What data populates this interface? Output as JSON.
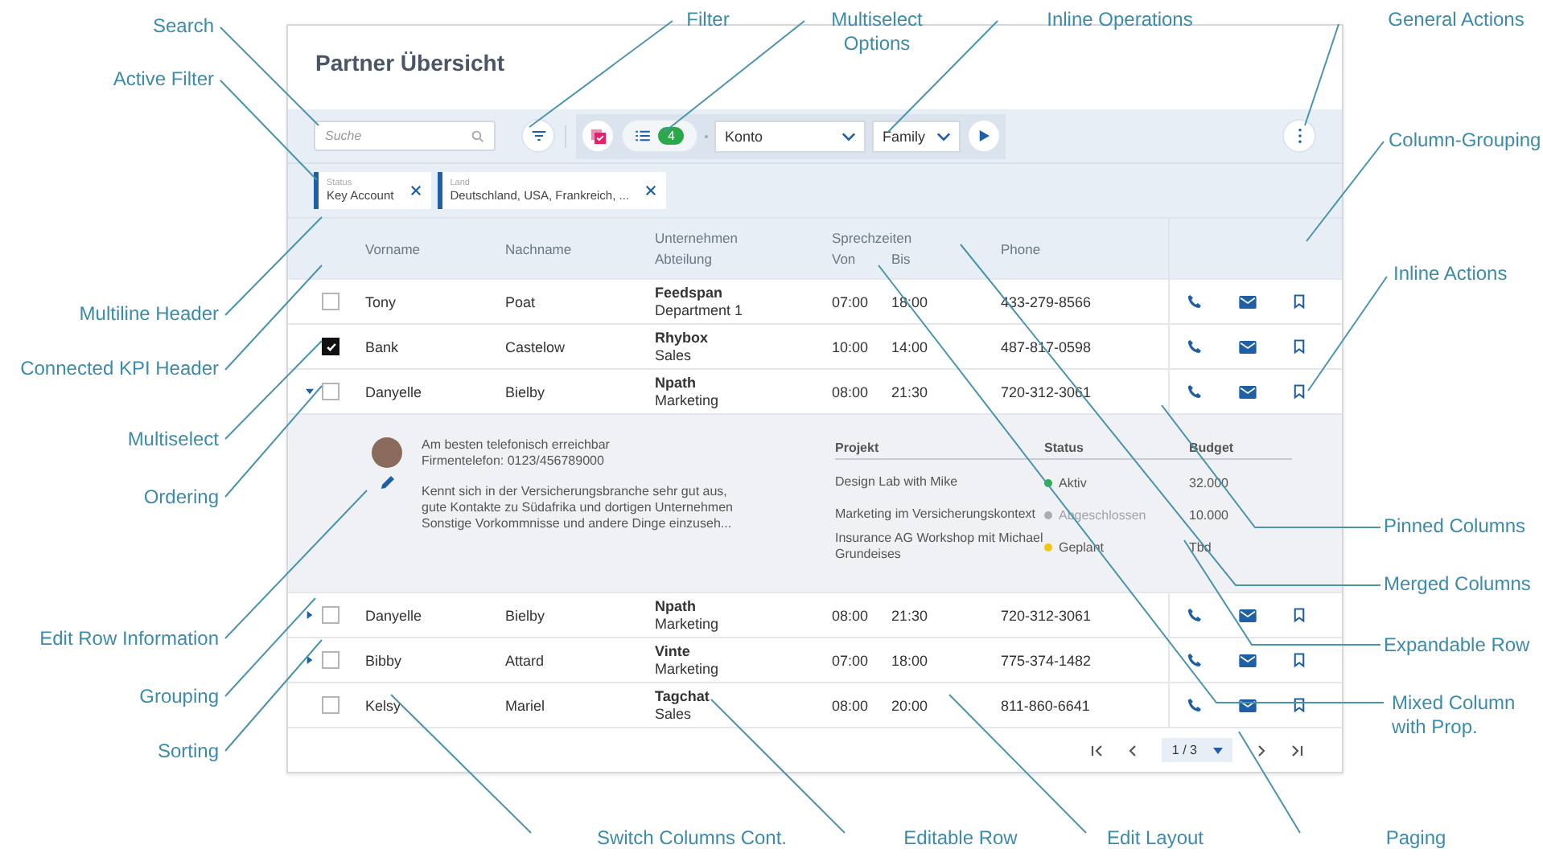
{
  "card": {
    "title": "Partner Übersicht",
    "toolbar": {
      "search": {
        "placeholder": "Suche"
      },
      "multiselect_count": "4",
      "selects": [
        "Konto",
        "Family"
      ]
    },
    "filters": [
      {
        "label": "Status",
        "value": "Key Account"
      },
      {
        "label": "Land",
        "value": "Deutschland, USA, Frankreich, ..."
      }
    ],
    "header": {
      "first": "Vorname",
      "last": "Nachname",
      "company": "Unternehmen",
      "department": "Abteilung",
      "hours": "Sprechzeiten",
      "from": "Von",
      "to": "Bis",
      "phone": "Phone"
    },
    "rows": [
      {
        "first": "Tony",
        "last": "Poat",
        "company": "Feedspan",
        "department": "Department 1",
        "from": "07:00",
        "to": "18:00",
        "phone": "433-279-8566",
        "checked": false,
        "expandable": false,
        "expanded": false
      },
      {
        "first": "Bank",
        "last": "Castelow",
        "company": "Rhybox",
        "department": "Sales",
        "from": "10:00",
        "to": "14:00",
        "phone": "487-817-0598",
        "checked": true,
        "expandable": false,
        "expanded": false
      },
      {
        "first": "Danyelle",
        "last": "Bielby",
        "company": "Npath",
        "department": "Marketing",
        "from": "08:00",
        "to": "21:30",
        "phone": "720-312-3061",
        "checked": false,
        "expandable": true,
        "expanded": true
      },
      {
        "first": "Danyelle",
        "last": "Bielby",
        "company": "Npath",
        "department": "Marketing",
        "from": "08:00",
        "to": "21:30",
        "phone": "720-312-3061",
        "checked": false,
        "expandable": true,
        "expanded": false
      },
      {
        "first": "Bibby",
        "last": "Attard",
        "company": "Vinte",
        "department": "Marketing",
        "from": "07:00",
        "to": "18:00",
        "phone": "775-374-1482",
        "checked": false,
        "expandable": true,
        "expanded": false
      },
      {
        "first": "Kelsy",
        "last": "Mariel",
        "company": "Tagchat",
        "department": "Sales",
        "from": "08:00",
        "to": "20:00",
        "phone": "811-860-6641",
        "checked": false,
        "expandable": false,
        "expanded": false
      }
    ],
    "detail": {
      "info": [
        "Am besten telefonisch erreichbar",
        "Firmentelefon: 0123/456789000"
      ],
      "note": [
        "Kennt sich in der Versicherungsbranche sehr gut aus,",
        "gute Kontakte zu Südafrika und dortigen Unternehmen",
        "Sonstige Vorkommnisse und andere Dinge einzuseh..."
      ],
      "columns": [
        "Projekt",
        "Status",
        "Budget"
      ],
      "projects": [
        {
          "name": "Design Lab with Mike",
          "status": "Aktiv",
          "color": "#2bb34a",
          "muted": false,
          "budget": "32.000"
        },
        {
          "name": "Marketing im Versicherungskontext",
          "status": "Abgeschlossen",
          "color": "#a9adb3",
          "muted": true,
          "budget": "10.000"
        },
        {
          "name": "Insurance AG Workshop mit Michael Grundeises",
          "status": "Geplant",
          "color": "#f2c418",
          "muted": false,
          "budget": "Tbd"
        }
      ]
    },
    "paging": "1 / 3"
  },
  "annotations": [
    "Filter",
    "Multiselect Options",
    "Inline Operations",
    "General Actions",
    "Search",
    "Active Filter",
    "Column-Grouping",
    "Inline Actions",
    "Multiline Header",
    "Connected KPI Header",
    "Multiselect",
    "Ordering",
    "Pinned Columns",
    "Merged Columns",
    "Edit Row Information",
    "Expandable Row",
    "Grouping",
    "Mixed Column with Prop.",
    "Sorting",
    "Switch Columns Cont.",
    "Editable Row",
    "Edit Layout",
    "Paging"
  ]
}
